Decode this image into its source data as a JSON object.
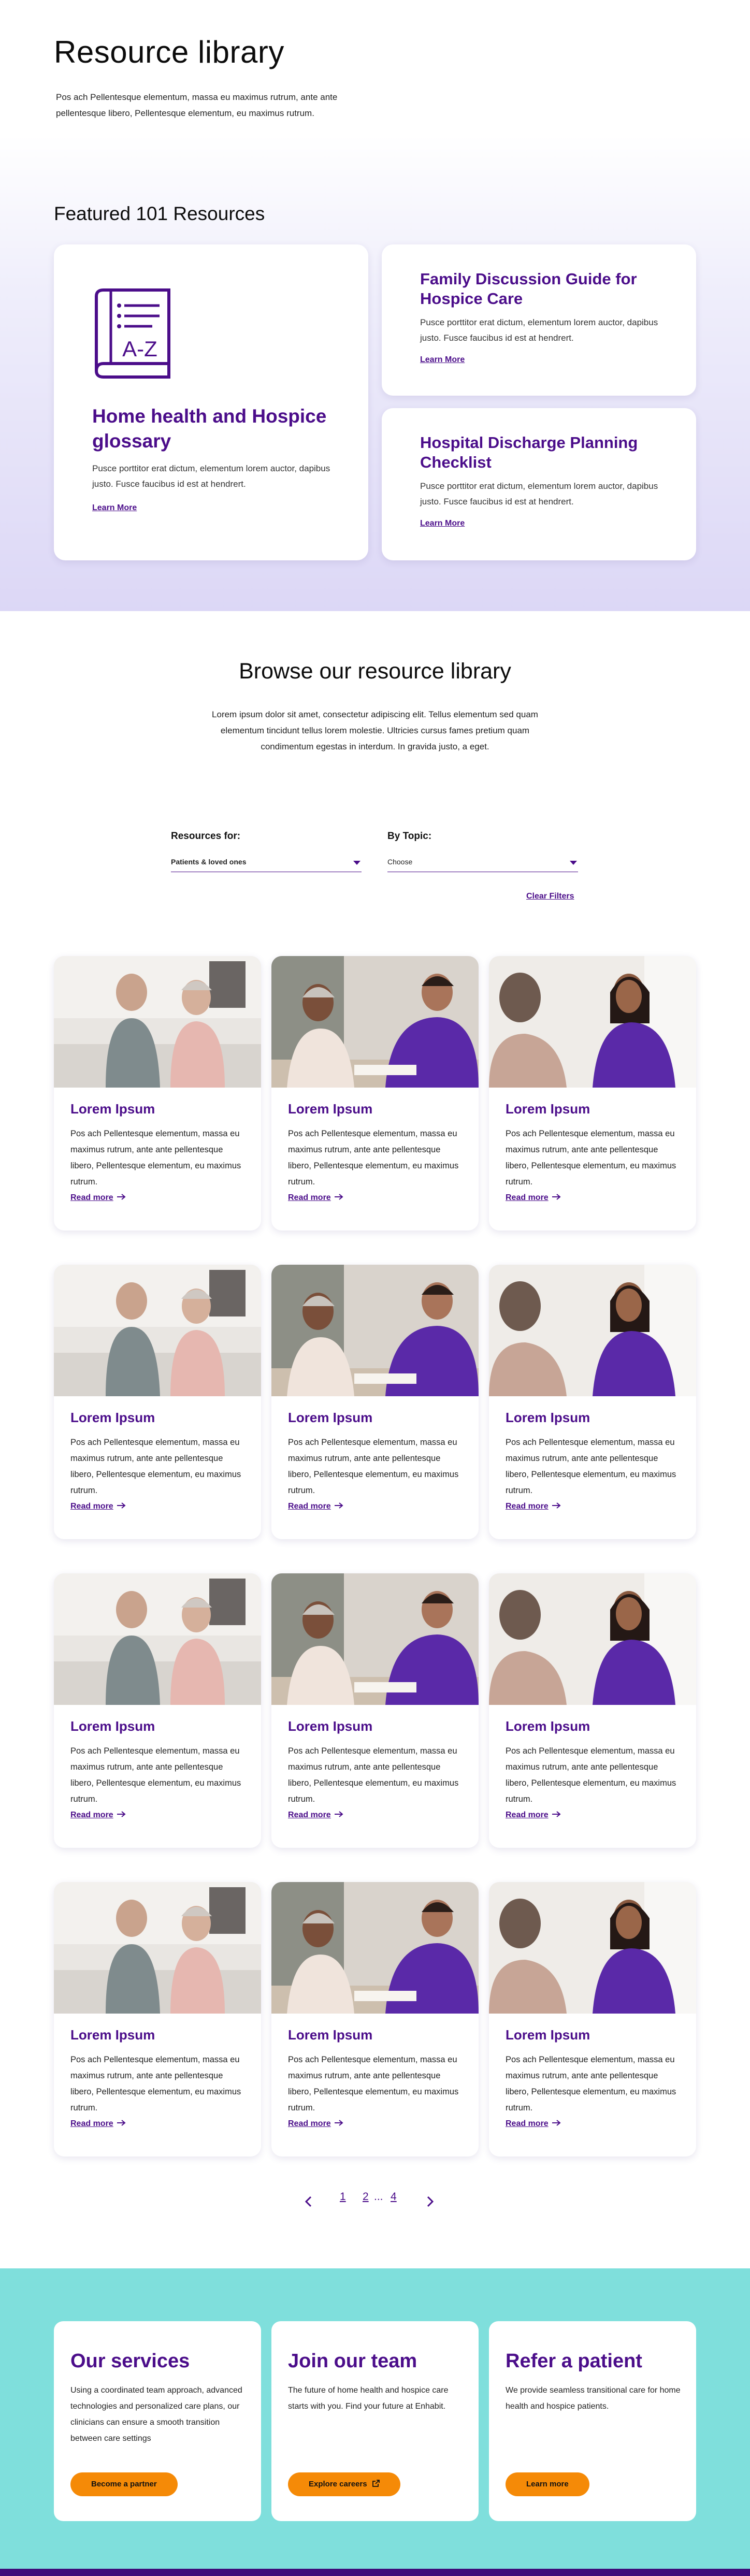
{
  "hero": {
    "title": "Resource library",
    "description": "Pos ach Pellentesque elementum, massa eu maximus rutrum, ante ante pellentesque libero, Pellentesque elementum,  eu maximus rutrum."
  },
  "featured": {
    "heading": "Featured 101 Resources",
    "main": {
      "icon_letters": "A-Z",
      "title": "Home health and Hospice glossary",
      "description": "Pusce porttitor erat dictum, elementum lorem auctor, dapibus justo. Fusce faucibus id est at hendrert.",
      "link": "Learn More"
    },
    "side": [
      {
        "title": "Family Discussion Guide for Hospice Care",
        "description": "Pusce porttitor erat dictum, elementum lorem auctor, dapibus justo. Fusce faucibus id est at hendrert.",
        "link": "Learn More"
      },
      {
        "title": "Hospital Discharge Planning Checklist",
        "description": "Pusce porttitor erat dictum, elementum lorem auctor, dapibus justo. Fusce faucibus id est at hendrert.",
        "link": "Learn More"
      }
    ]
  },
  "browse": {
    "heading": "Browse our resource library",
    "description": "Lorem ipsum dolor sit amet, consectetur adipiscing elit. Tellus elementum sed quam elementum tincidunt tellus lorem molestie. Ultricies cursus fames pretium quam condimentum egestas in interdum. In gravida justo, a eget.",
    "filters": {
      "resources_label": "Resources for:",
      "resources_value": "Patients & loved ones",
      "topic_label": "By Topic:",
      "topic_value": "Choose",
      "clear": "Clear Filters"
    }
  },
  "resources": [
    {
      "title": "Lorem Ipsum",
      "description": "Pos ach Pellentesque elementum, massa eu maximus rutrum, ante ante pellentesque libero, Pellentesque elementum,  eu maximus rutrum.",
      "link": "Read more",
      "image": "couple-photo"
    },
    {
      "title": "Lorem Ipsum",
      "description": "Pos ach Pellentesque elementum, massa eu maximus rutrum, ante ante pellentesque libero, Pellentesque elementum,  eu maximus rutrum.",
      "link": "Read more",
      "image": "nurse-man-photo"
    },
    {
      "title": "Lorem Ipsum",
      "description": "Pos ach Pellentesque elementum, massa eu maximus rutrum, ante ante pellentesque libero, Pellentesque elementum,  eu maximus rutrum.",
      "link": "Read more",
      "image": "nurse-woman-photo"
    },
    {
      "title": "Lorem Ipsum",
      "description": "Pos ach Pellentesque elementum, massa eu maximus rutrum, ante ante pellentesque libero, Pellentesque elementum,  eu maximus rutrum.",
      "link": "Read more",
      "image": "couple-photo"
    },
    {
      "title": "Lorem Ipsum",
      "description": "Pos ach Pellentesque elementum, massa eu maximus rutrum, ante ante pellentesque libero, Pellentesque elementum,  eu maximus rutrum.",
      "link": "Read more",
      "image": "nurse-man-photo"
    },
    {
      "title": "Lorem Ipsum",
      "description": "Pos ach Pellentesque elementum, massa eu maximus rutrum, ante ante pellentesque libero, Pellentesque elementum,  eu maximus rutrum.",
      "link": "Read more",
      "image": "nurse-woman-photo"
    },
    {
      "title": "Lorem Ipsum",
      "description": "Pos ach Pellentesque elementum, massa eu maximus rutrum, ante ante pellentesque libero, Pellentesque elementum,  eu maximus rutrum.",
      "link": "Read more",
      "image": "couple-photo"
    },
    {
      "title": "Lorem Ipsum",
      "description": "Pos ach Pellentesque elementum, massa eu maximus rutrum, ante ante pellentesque libero, Pellentesque elementum,  eu maximus rutrum.",
      "link": "Read more",
      "image": "nurse-man-photo"
    },
    {
      "title": "Lorem Ipsum",
      "description": "Pos ach Pellentesque elementum, massa eu maximus rutrum, ante ante pellentesque libero, Pellentesque elementum,  eu maximus rutrum.",
      "link": "Read more",
      "image": "nurse-woman-photo"
    },
    {
      "title": "Lorem Ipsum",
      "description": "Pos ach Pellentesque elementum, massa eu maximus rutrum, ante ante pellentesque libero, Pellentesque elementum,  eu maximus rutrum.",
      "link": "Read more",
      "image": "couple-photo"
    },
    {
      "title": "Lorem Ipsum",
      "description": "Pos ach Pellentesque elementum, massa eu maximus rutrum, ante ante pellentesque libero, Pellentesque elementum,  eu maximus rutrum.",
      "link": "Read more",
      "image": "nurse-man-photo"
    },
    {
      "title": "Lorem Ipsum",
      "description": "Pos ach Pellentesque elementum, massa eu maximus rutrum, ante ante pellentesque libero, Pellentesque elementum,  eu maximus rutrum.",
      "link": "Read more",
      "image": "nurse-woman-photo"
    }
  ],
  "pagination": {
    "prev_icon": "chevron-left-icon",
    "next_icon": "chevron-right-icon",
    "pages": [
      "1",
      "2",
      "4"
    ],
    "ellipsis": "..."
  },
  "services": [
    {
      "title": "Our services",
      "description": "Using a coordinated team approach, advanced technologies and personalized care plans, our clinicians can ensure a smooth transition between care settings",
      "button": "Become a partner"
    },
    {
      "title": "Join our team",
      "description": "The future of home health and hospice care starts with you. Find your future at Enhabit.",
      "button": "Explore careers"
    },
    {
      "title": "Refer a patient",
      "description": "We provide seamless transitional care for home health and hospice patients.",
      "button": "Learn more"
    }
  ],
  "colors": {
    "brand_purple": "#4b0d8a",
    "accent_orange": "#f58a07",
    "teal": "#7fdfdc",
    "lavender": "#dcd7f6"
  }
}
